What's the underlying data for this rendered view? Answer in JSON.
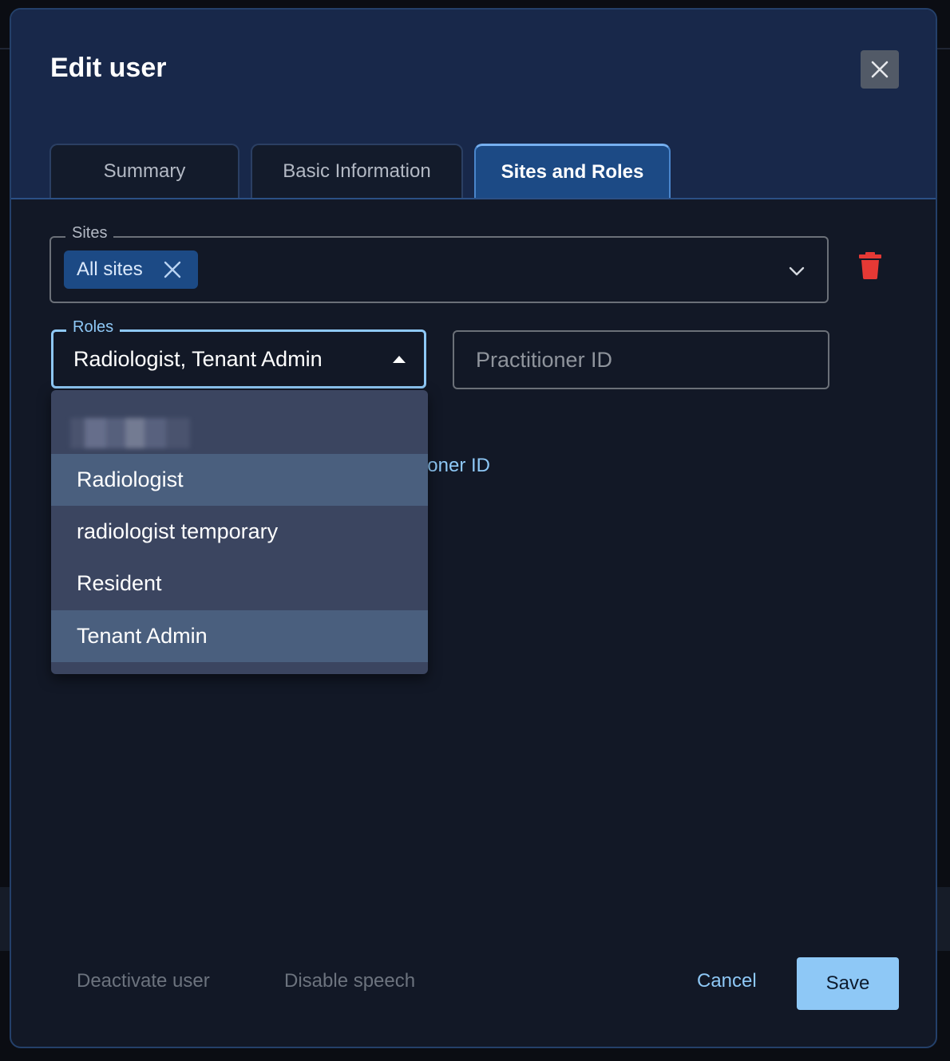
{
  "dialog": {
    "title": "Edit user",
    "close_label": "Close"
  },
  "tabs": [
    {
      "label": "Summary",
      "active": false
    },
    {
      "label": "Basic Information",
      "active": false
    },
    {
      "label": "Sites and Roles",
      "active": true
    }
  ],
  "sites": {
    "label": "Sites",
    "chips": [
      "All sites"
    ]
  },
  "roles": {
    "label": "Roles",
    "value": "Radiologist, Tenant Admin",
    "options": [
      {
        "label": "",
        "selected": false,
        "redacted": true
      },
      {
        "label": "Radiologist",
        "selected": true
      },
      {
        "label": "radiologist temporary",
        "selected": false
      },
      {
        "label": "Resident",
        "selected": false
      },
      {
        "label": "Tenant Admin",
        "selected": true
      }
    ]
  },
  "practitioner": {
    "placeholder": "Practitioner ID",
    "add_link_visible": "oner ID"
  },
  "footer": {
    "deactivate": "Deactivate user",
    "disable_speech": "Disable speech",
    "cancel": "Cancel",
    "save": "Save"
  },
  "colors": {
    "accent": "#8ec8f6",
    "danger": "#e53935",
    "tab_active": "#1c4a85"
  }
}
